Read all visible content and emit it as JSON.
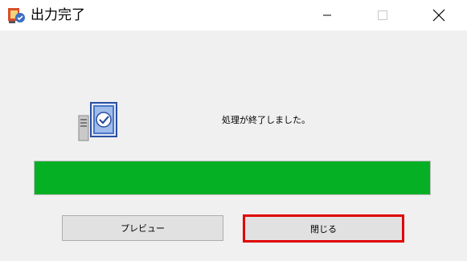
{
  "window": {
    "title": "出力完了"
  },
  "titlebar_buttons": {
    "minimize_icon": "minimize-icon",
    "maximize_icon": "maximize-icon",
    "close_icon": "close-icon"
  },
  "main": {
    "message": "処理が終了しました。",
    "icon": "server-check-icon",
    "progress": {
      "fraction": 1.0,
      "fill_color": "#06b025"
    }
  },
  "buttons": {
    "preview_label": "プレビュー",
    "close_label": "閉じる"
  },
  "colors": {
    "highlight": "#e00000"
  }
}
